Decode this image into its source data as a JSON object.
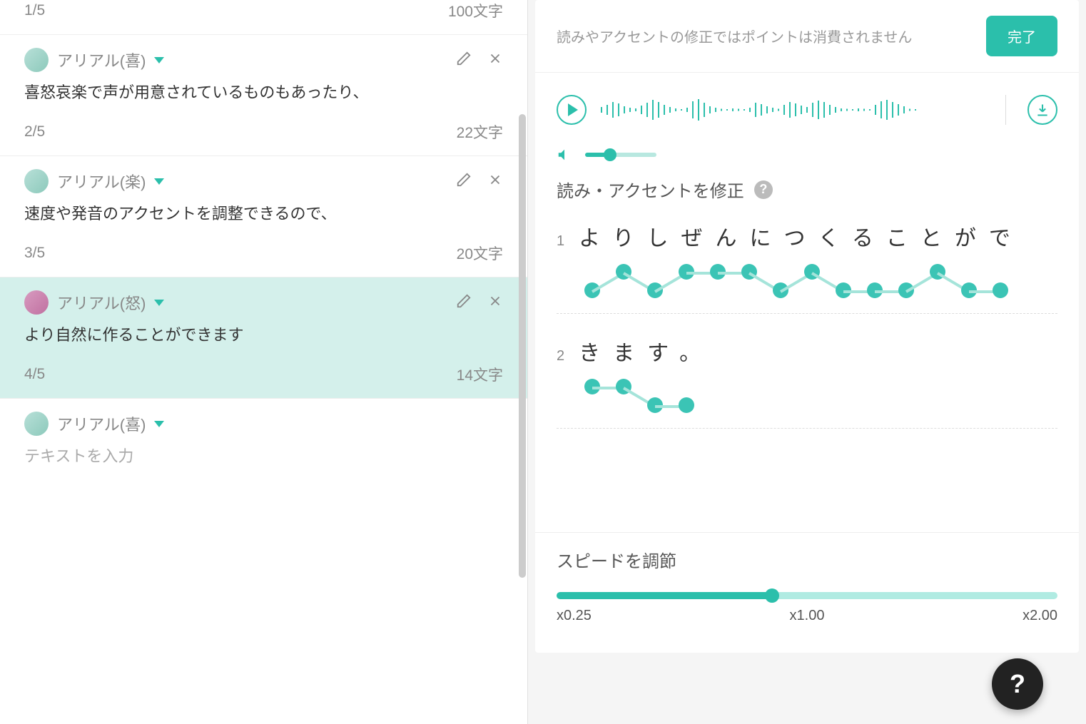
{
  "leftPanel": {
    "cards": [
      {
        "index": "1/5",
        "voice": "",
        "text": "",
        "chars": "100文字",
        "selected": false,
        "partial": true
      },
      {
        "index": "2/5",
        "voice": "アリアル(喜)",
        "text": "喜怒哀楽で声が用意されているものもあったり、",
        "chars": "22文字",
        "selected": false,
        "avatarClass": ""
      },
      {
        "index": "3/5",
        "voice": "アリアル(楽)",
        "text": "速度や発音のアクセントを調整できるので、",
        "chars": "20文字",
        "selected": false,
        "avatarClass": ""
      },
      {
        "index": "4/5",
        "voice": "アリアル(怒)",
        "text": "より自然に作ることができます",
        "chars": "14文字",
        "selected": true,
        "avatarClass": "angry"
      },
      {
        "index": "",
        "voice": "アリアル(喜)",
        "text": "テキストを入力",
        "chars": "",
        "selected": false,
        "placeholder": true,
        "avatarClass": ""
      }
    ]
  },
  "rightPanel": {
    "notice": "読みやアクセントの修正ではポイントは消費されません",
    "doneLabel": "完了",
    "accentTitle": "読み・アクセントを修正",
    "accentLines": [
      {
        "num": "1",
        "text": "よりしぜんにつくることがで",
        "pitch": [
          1,
          0,
          1,
          0,
          0,
          0,
          1,
          0,
          1,
          1,
          1,
          0,
          1,
          1
        ]
      },
      {
        "num": "2",
        "text": "きます。",
        "pitch": [
          0,
          0,
          1,
          1
        ]
      }
    ],
    "speedTitle": "スピードを調節",
    "speedLabels": {
      "min": "x0.25",
      "mid": "x1.00",
      "max": "x2.00"
    }
  },
  "fab": "?"
}
